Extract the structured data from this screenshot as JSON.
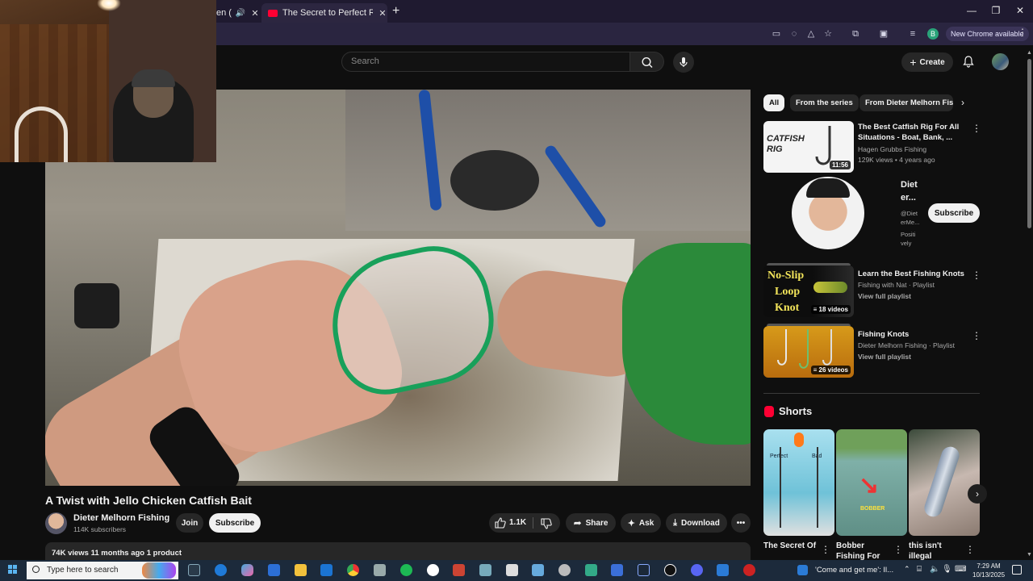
{
  "browser": {
    "tabs": [
      {
        "label": "en ("
      },
      {
        "label": "The Secret to Perfect Rigging: I"
      }
    ],
    "new_chrome_label": "New Chrome available"
  },
  "header": {
    "search_placeholder": "Search",
    "create_label": "Create"
  },
  "video": {
    "title": "A Twist with Jello Chicken Catfish Bait",
    "channel_name": "Dieter Melhorn Fishing",
    "subscribers": "114K subscribers",
    "join_label": "Join",
    "subscribe_label": "Subscribe",
    "like_count": "1.1K",
    "share_label": "Share",
    "ask_label": "Ask",
    "download_label": "Download",
    "description_meta": "74K views  11 months ago  1 product"
  },
  "sidebar": {
    "chips": [
      "All",
      "From the series",
      "From Dieter Melhorn Fishi"
    ],
    "items": [
      {
        "title": "The Best Catfish Rig For All Situations - Boat, Bank, ...",
        "channel": "Hagen Grubbs Fishing",
        "meta": "129K views • 4 years ago",
        "duration": "11:56",
        "thumb_text": "CATFISH RIG"
      },
      {
        "title": "Learn the Best Fishing Knots",
        "channel": "Fishing with Nat · Playlist",
        "meta": "View full playlist",
        "count": "18 videos",
        "thumb_text_1": "No-Slip",
        "thumb_text_2": "Loop",
        "thumb_text_3": "Knot"
      },
      {
        "title": "Fishing Knots",
        "channel": "Dieter Melhorn Fishing · Playlist",
        "meta": "View full playlist",
        "count": "26 videos"
      }
    ],
    "ad": {
      "name_line1": "Diet",
      "name_line2": "er...",
      "sub_line1": "@Diet",
      "sub_line2": "erMe...",
      "sub_line3": "Positi",
      "sub_line4": "vely",
      "subscribe_label": "Subscribe"
    },
    "shorts_label": "Shorts",
    "shorts": [
      {
        "title": "The Secret Of",
        "thumb_a": "Perfect",
        "thumb_b": "Bad"
      },
      {
        "title": "Bobber Fishing For",
        "thumb_a": "BOBBER"
      },
      {
        "title": "this isn't illegal"
      }
    ]
  },
  "taskbar": {
    "search_placeholder": "Type here to search",
    "notification": "'Come and get me': Il...",
    "time": "7:29 AM",
    "date": "10/13/2025"
  },
  "colors": {
    "background": "#0f0f0f",
    "accent_red": "#ff0033",
    "chip_bg": "#272727"
  }
}
